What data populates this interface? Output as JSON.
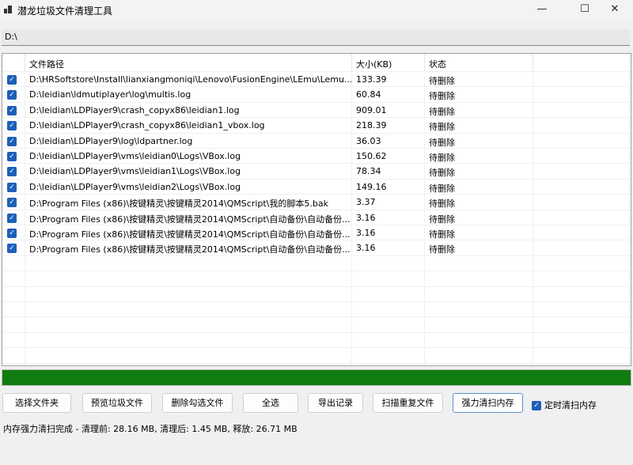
{
  "window": {
    "title": "潜龙垃圾文件清理工具",
    "minimize": "—",
    "maximize": "☐",
    "close": "✕"
  },
  "path_input": {
    "value": "D:\\"
  },
  "table": {
    "headers": [
      "",
      "文件路径",
      "大小(KB)",
      "状态"
    ],
    "rows": [
      {
        "checked": true,
        "path": "D:\\HRSoftstore\\Install\\lianxiangmoniqi\\Lenovo\\FusionEngine\\LEmu\\Lemu...",
        "size": "133.39",
        "status": "待删除"
      },
      {
        "checked": true,
        "path": "D:\\leidian\\ldmutiplayer\\log\\multis.log",
        "size": "60.84",
        "status": "待删除"
      },
      {
        "checked": true,
        "path": "D:\\leidian\\LDPlayer9\\crash_copyx86\\leidian1.log",
        "size": "909.01",
        "status": "待删除"
      },
      {
        "checked": true,
        "path": "D:\\leidian\\LDPlayer9\\crash_copyx86\\leidian1_vbox.log",
        "size": "218.39",
        "status": "待删除"
      },
      {
        "checked": true,
        "path": "D:\\leidian\\LDPlayer9\\log\\ldpartner.log",
        "size": "36.03",
        "status": "待删除"
      },
      {
        "checked": true,
        "path": "D:\\leidian\\LDPlayer9\\vms\\leidian0\\Logs\\VBox.log",
        "size": "150.62",
        "status": "待删除"
      },
      {
        "checked": true,
        "path": "D:\\leidian\\LDPlayer9\\vms\\leidian1\\Logs\\VBox.log",
        "size": "78.34",
        "status": "待删除"
      },
      {
        "checked": true,
        "path": "D:\\leidian\\LDPlayer9\\vms\\leidian2\\Logs\\VBox.log",
        "size": "149.16",
        "status": "待删除"
      },
      {
        "checked": true,
        "path": "D:\\Program Files (x86)\\按键精灵\\按键精灵2014\\QMScript\\我的脚本5.bak",
        "size": "3.37",
        "status": "待删除"
      },
      {
        "checked": true,
        "path": "D:\\Program Files (x86)\\按键精灵\\按键精灵2014\\QMScript\\自动备份\\自动备份...",
        "size": "3.16",
        "status": "待删除"
      },
      {
        "checked": true,
        "path": "D:\\Program Files (x86)\\按键精灵\\按键精灵2014\\QMScript\\自动备份\\自动备份...",
        "size": "3.16",
        "status": "待删除"
      },
      {
        "checked": true,
        "path": "D:\\Program Files (x86)\\按键精灵\\按键精灵2014\\QMScript\\自动备份\\自动备份...",
        "size": "3.16",
        "status": "待删除"
      }
    ]
  },
  "progress": {
    "percent": 100,
    "color": "#107c10"
  },
  "buttons": [
    "选择文件夹",
    "预览垃圾文件",
    "删除勾选文件",
    "全选",
    "导出记录",
    "扫描重复文件",
    "强力清扫内存"
  ],
  "timer_option": {
    "label": "定时清扫内存",
    "checked": true
  },
  "status_text": "内存强力清扫完成 - 清理前: 28.16 MB, 清理后: 1.45 MB, 释放: 26.71 MB"
}
